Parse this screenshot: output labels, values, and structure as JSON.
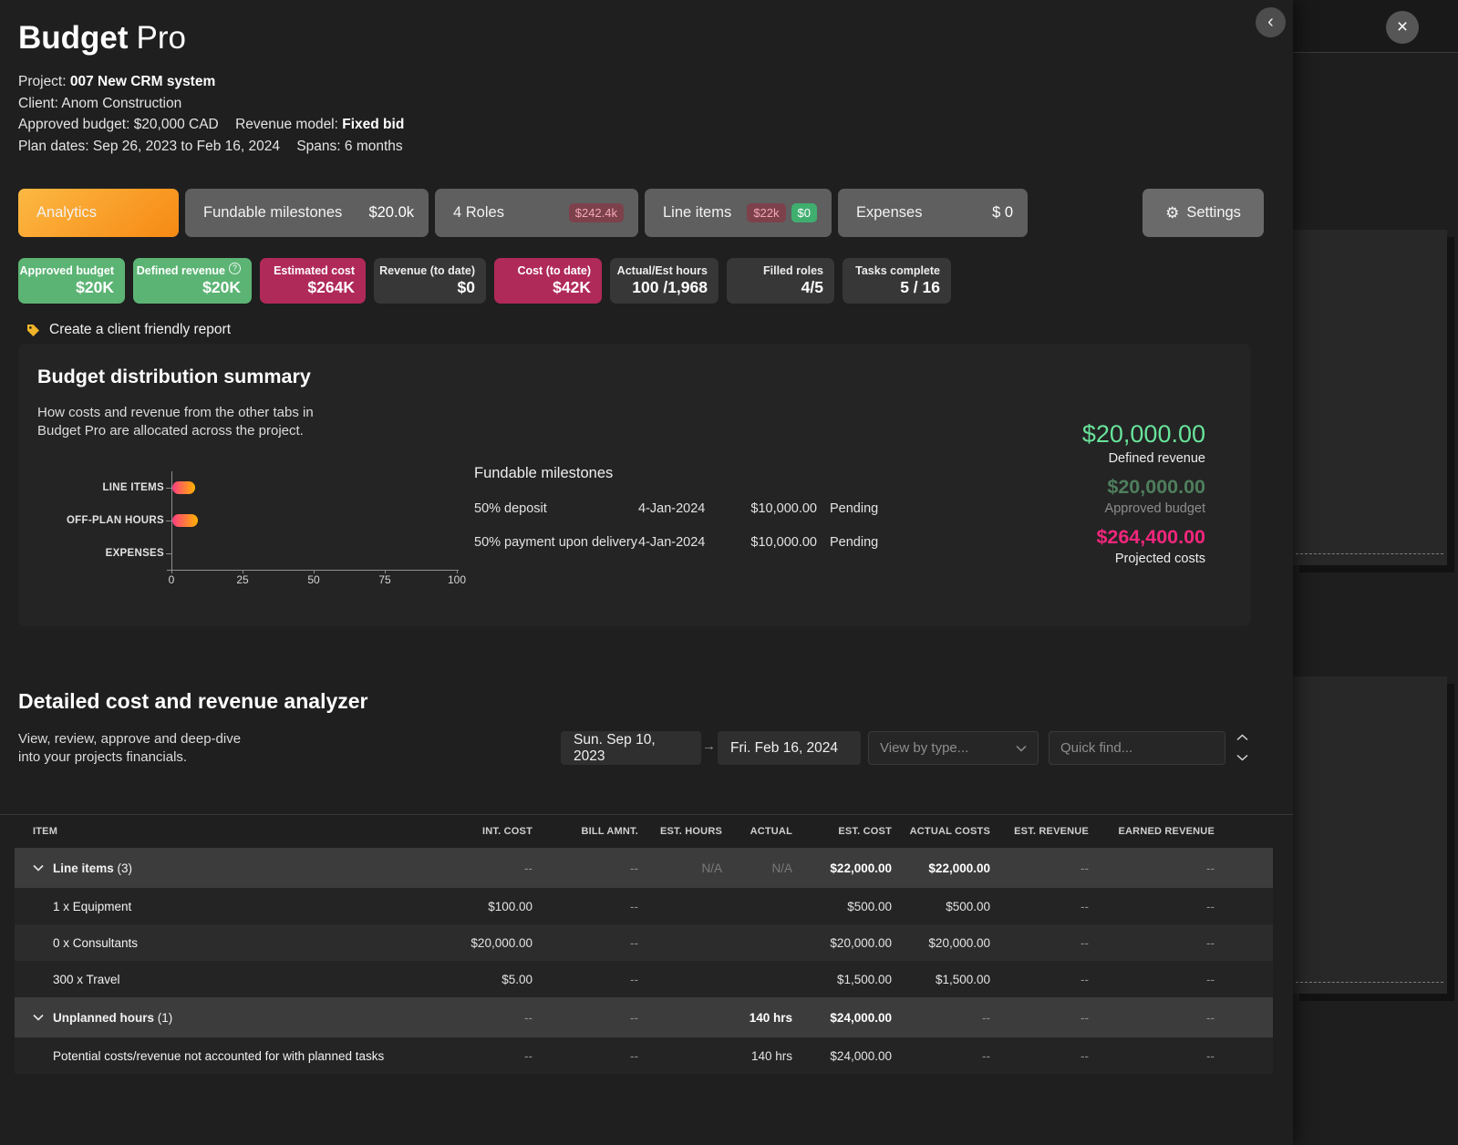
{
  "app": {
    "title_bold": "Budget",
    "title_light": "Pro"
  },
  "header": {
    "project_label": "Project:",
    "project_value": "007 New CRM system",
    "client_label": "Client:",
    "client_value": "Anom Construction",
    "budget_label": "Approved budget:",
    "budget_value": "$20,000 CAD",
    "revenue_model_label": "Revenue model:",
    "revenue_model_value": "Fixed bid",
    "plan_dates_label": "Plan dates:",
    "plan_start": "Sep 26, 2023",
    "plan_to": "to",
    "plan_end": "Feb 16, 2024",
    "spans_label": "Spans:",
    "spans_value": "6 months",
    "back_icon": "‹",
    "close_icon": "×"
  },
  "tabs": {
    "analytics": {
      "label": "Analytics"
    },
    "milestones": {
      "label": "Fundable milestones",
      "value": "$20.0k"
    },
    "roles": {
      "label": "4 Roles",
      "badge": "$242.4k"
    },
    "line_items": {
      "label": "Line items",
      "badge_cost": "$22k",
      "badge_zero": "$0"
    },
    "expenses": {
      "label": "Expenses",
      "value": "$ 0"
    },
    "settings": {
      "label": "Settings",
      "icon": "⚙"
    }
  },
  "chips": [
    {
      "label": "Approved budget",
      "value": "$20K"
    },
    {
      "label": "Defined revenue",
      "value": "$20K",
      "info": "?"
    },
    {
      "label": "Estimated cost",
      "value": "$264K"
    },
    {
      "label": "Revenue (to date)",
      "value": "$0"
    },
    {
      "label": "Cost (to date)",
      "value": "$42K"
    },
    {
      "label": "Actual/Est hours",
      "value": "100 /1,968"
    },
    {
      "label": "Filled roles",
      "value": "4/5"
    },
    {
      "label": "Tasks complete",
      "value": "5 / 16"
    }
  ],
  "report_link": {
    "label": "Create a client friendly report"
  },
  "summary": {
    "title": "Budget distribution summary",
    "desc1": "How costs and revenue from the other tabs in",
    "desc2": "Budget Pro are allocated across the project.",
    "milestones_title": "Fundable milestones",
    "milestones": [
      {
        "name": "50% deposit",
        "date": "4-Jan-2024",
        "amount": "$10,000.00",
        "status": "Pending"
      },
      {
        "name": "50% payment upon delivery",
        "date": "4-Jan-2024",
        "amount": "$10,000.00",
        "status": "Pending"
      }
    ],
    "totals": {
      "defined_revenue": {
        "amount": "$20,000.00",
        "label": "Defined revenue"
      },
      "approved_budget": {
        "amount": "$20,000.00",
        "label": "Approved budget"
      },
      "projected_costs": {
        "amount": "$264,400.00",
        "label": "Projected costs"
      }
    }
  },
  "chart_data": {
    "type": "bar",
    "orientation": "horizontal",
    "title": "Budget distribution summary",
    "categories": [
      "LINE ITEMS",
      "OFF-PLAN HOURS",
      "EXPENSES"
    ],
    "values": [
      8,
      9,
      0
    ],
    "xlim": [
      0,
      100
    ],
    "xticks": [
      "0",
      "25",
      "50",
      "75",
      "100"
    ],
    "grid": false,
    "legend": false,
    "bar_gradient": [
      "#ff3d81",
      "#ffb300"
    ]
  },
  "analyzer": {
    "title": "Detailed cost and revenue analyzer",
    "desc1": "View, review, approve and deep-dive",
    "desc2": "into your projects financials.",
    "date_from": "Sun. Sep 10, 2023",
    "date_to": "Fri. Feb 16, 2024",
    "arrow_icon": "→",
    "view_by_placeholder": "View by type...",
    "quick_find_placeholder": "Quick find...",
    "table": {
      "columns": [
        "ITEM",
        "INT. COST",
        "BILL AMNT.",
        "EST. HOURS",
        "ACTUAL",
        "EST. COST",
        "ACTUAL COSTS",
        "EST. REVENUE",
        "EARNED REVENUE"
      ],
      "rows": [
        {
          "name": "Line items",
          "count": "(3)",
          "group": true,
          "cells": [
            "--",
            "--",
            "N/A",
            "N/A",
            "$22,000.00",
            "$22,000.00",
            "--",
            "--"
          ]
        },
        {
          "name": "1 x Equipment",
          "cells": [
            "$100.00",
            "--",
            "",
            "",
            "$500.00",
            "$500.00",
            "--",
            "--"
          ]
        },
        {
          "name": "0 x Consultants",
          "cells": [
            "$20,000.00",
            "--",
            "",
            "",
            "$20,000.00",
            "$20,000.00",
            "--",
            "--"
          ]
        },
        {
          "name": "300 x Travel",
          "cells": [
            "$5.00",
            "--",
            "",
            "",
            "$1,500.00",
            "$1,500.00",
            "--",
            "--"
          ]
        },
        {
          "name": "Unplanned hours",
          "count": "(1)",
          "group": true,
          "cells": [
            "--",
            "--",
            "",
            "140 hrs",
            "$24,000.00",
            "--",
            "--",
            "--"
          ]
        },
        {
          "name": "Potential costs/revenue not accounted for with planned tasks",
          "cells": [
            "--",
            "--",
            "",
            "140 hrs",
            "$24,000.00",
            "--",
            "--",
            "--"
          ]
        }
      ]
    }
  },
  "colors": {
    "accent_orange": "#f68a14",
    "positive_green": "#5cb474",
    "cost_magenta": "#b02a59",
    "mint_text": "#68e39b",
    "pink_text": "#f2267c",
    "tag_yellow": "#f0b429"
  }
}
